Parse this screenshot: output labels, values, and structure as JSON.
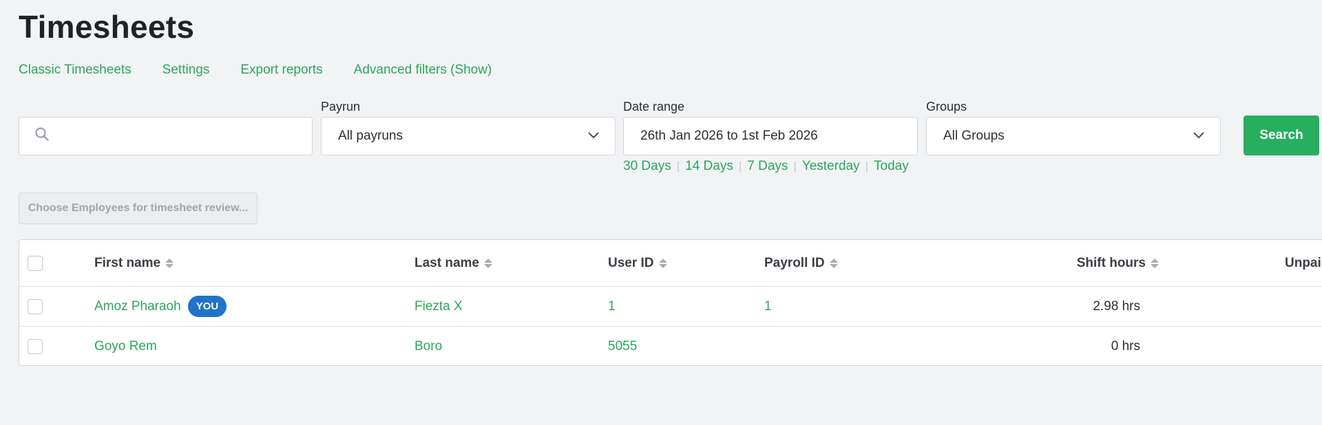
{
  "page": {
    "title": "Timesheets"
  },
  "subnav": [
    {
      "label": "Classic Timesheets"
    },
    {
      "label": "Settings"
    },
    {
      "label": "Export reports"
    },
    {
      "label": "Advanced filters (Show)"
    }
  ],
  "filters": {
    "search": {
      "value": "",
      "placeholder": ""
    },
    "payrun": {
      "label": "Payrun",
      "value": "All payruns"
    },
    "date_range": {
      "label": "Date range",
      "value": "26th Jan 2026 to 1st Feb 2026"
    },
    "groups": {
      "label": "Groups",
      "value": "All Groups"
    },
    "search_button": "Search",
    "quick_ranges": [
      {
        "label": "30 Days"
      },
      {
        "label": "14 Days"
      },
      {
        "label": "7 Days"
      },
      {
        "label": "Yesterday"
      },
      {
        "label": "Today"
      }
    ]
  },
  "choose_employees_button": "Choose Employees for timesheet review...",
  "table": {
    "columns": {
      "first_name": "First name",
      "last_name": "Last name",
      "user_id": "User ID",
      "payroll_id": "Payroll ID",
      "shift_hours": "Shift hours",
      "unpaid": "Unpai"
    },
    "rows": [
      {
        "first_name": "Amoz Pharaoh",
        "badge": "YOU",
        "last_name": "Fiezta X",
        "user_id": "1",
        "payroll_id": "1",
        "shift_hours": "2.98 hrs"
      },
      {
        "first_name": "Goyo Rem",
        "last_name": "Boro",
        "user_id": "5055",
        "payroll_id": "",
        "shift_hours": "0 hrs"
      }
    ]
  },
  "colors": {
    "accent_green": "#2ea55a",
    "button_green": "#27ae5f",
    "badge_blue": "#1f73c9"
  }
}
